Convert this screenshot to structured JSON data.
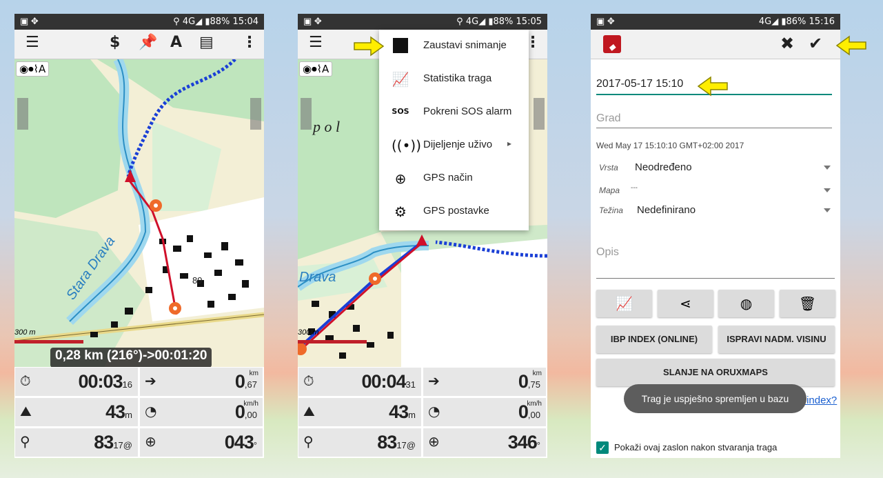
{
  "screen1": {
    "status_time": "15:04",
    "status_battery": "88%",
    "status_network": "4G",
    "map_label": "Stara Drava",
    "map_label_num": "89",
    "scale": "300 m",
    "route_info": "0,28 km (216°)->00:01:20",
    "stats": {
      "time": "00:03",
      "time_small": "16",
      "distance": "0",
      "distance_small": ",67",
      "distance_unit": "km",
      "altitude": "43",
      "altitude_unit": "m",
      "speed": "0",
      "speed_small": ",00",
      "speed_unit": "km/h",
      "satellites": "83",
      "satellites_sup": "17",
      "satellites_sub": "@",
      "heading": "043",
      "heading_unit": "°"
    }
  },
  "screen2": {
    "status_time": "15:05",
    "status_battery": "88%",
    "status_network": "4G",
    "map_label": "Drava",
    "map_label2": "p o l",
    "scale": "300 m",
    "menu": [
      {
        "icon": "stop-icon",
        "label": "Zaustavi snimanje"
      },
      {
        "icon": "statistics-icon",
        "label": "Statistika traga"
      },
      {
        "icon": "sos-icon",
        "label": "Pokreni SOS alarm",
        "icon_text": "SOS"
      },
      {
        "icon": "live-share-icon",
        "label": "Dijeljenje uživo",
        "submenu": "▸"
      },
      {
        "icon": "gps-mode-icon",
        "label": "GPS način"
      },
      {
        "icon": "gps-settings-icon",
        "label": "GPS postavke"
      }
    ],
    "stats": {
      "time": "00:04",
      "time_small": "31",
      "distance": "0",
      "distance_small": ",75",
      "distance_unit": "km",
      "altitude": "43",
      "altitude_unit": "m",
      "speed": "0",
      "speed_small": ",00",
      "speed_unit": "km/h",
      "satellites": "83",
      "satellites_sup": "17",
      "satellites_sub": "@",
      "heading": "346",
      "heading_unit": "°"
    }
  },
  "screen3": {
    "status_time": "15:16",
    "status_battery": "86%",
    "status_network": "4G",
    "name_value": "2017-05-17 15:10",
    "city_placeholder": "Grad",
    "date_text": "Wed May 17 15:10:10 GMT+02:00 2017",
    "type_label": "Vrsta",
    "type_value": "Neodređeno",
    "map_label": "Mapa",
    "map_value": "---",
    "difficulty_label": "Težina",
    "difficulty_value": "Nedefinirano",
    "description_placeholder": "Opis",
    "btn_ibp": "IBP INDEX (ONLINE)",
    "btn_fix_alt": "ISPRAVI NADM. VISINU",
    "btn_send": "SLANJE NA ORUXMAPS",
    "toast": "Trag je uspješno spremljen u bazu",
    "ibp_link": "IBP index?",
    "checkbox_label": "Pokaži ovaj zaslon nakon stvaranja traga",
    "checkbox_checked": true
  },
  "colors": {
    "accent": "#00897b",
    "track_blue": "#1a3fd6",
    "track_red": "#d0102a",
    "arrow_yellow": "#ffee00"
  }
}
